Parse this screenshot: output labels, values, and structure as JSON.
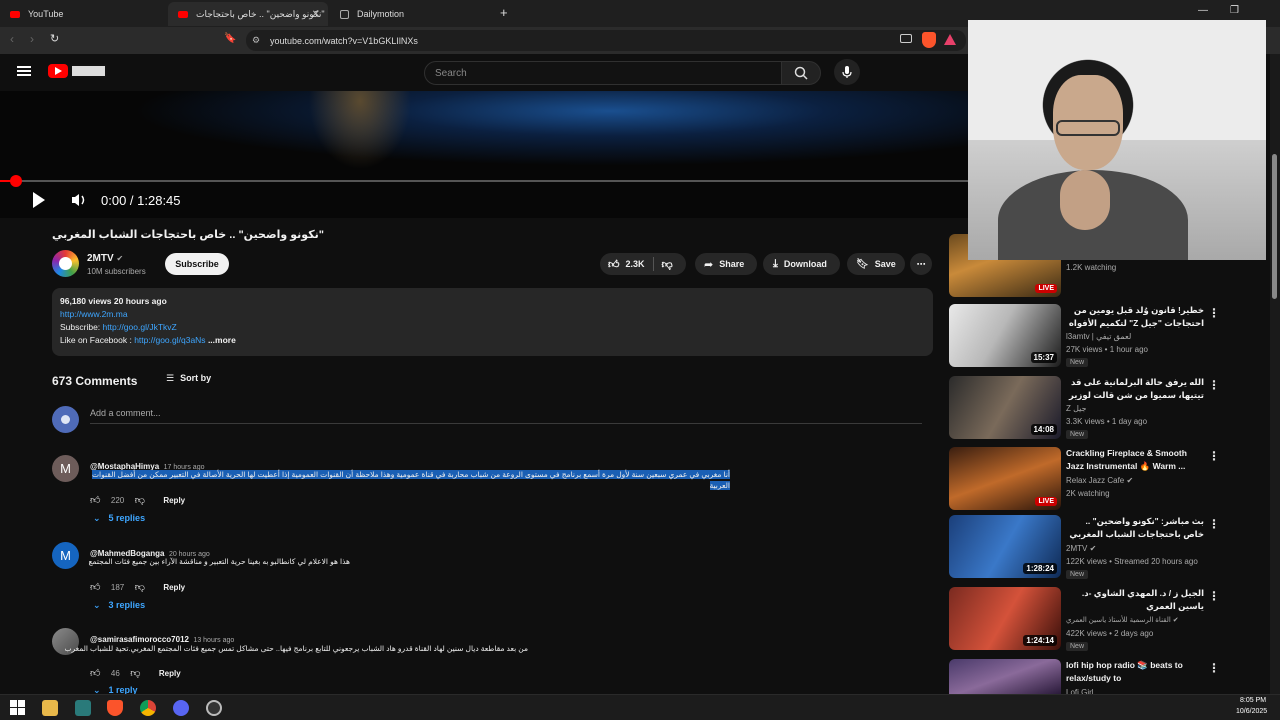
{
  "browser": {
    "tabs": [
      {
        "label": "YouTube"
      },
      {
        "label": "\"نكونو واضحين\" .. خاص باحتجاجات"
      },
      {
        "label": "Dailymotion"
      }
    ],
    "url": "youtube.com/watch?v=V1bGKLIlNXs"
  },
  "header": {
    "search_placeholder": "Search"
  },
  "player": {
    "time": "0:00 / 1:28:45",
    "progress_fraction": 0.0
  },
  "video": {
    "title": "\"نكونو واضحين\" .. خاص باحتجاجات الشباب المغربي",
    "channel": "2MTV",
    "subscribers": "10M subscribers",
    "subscribe_label": "Subscribe",
    "likes": "2.3K",
    "share_label": "Share",
    "download_label": "Download",
    "save_label": "Save"
  },
  "description": {
    "stats": "96,180 views  20 hours ago",
    "link1": "http://www.2m.ma",
    "subscribe_prefix": "Subscribe:",
    "subscribe_link": "http://goo.gl/JkTkvZ",
    "facebook_prefix": "Like on Facebook :",
    "facebook_link": "http://goo.gl/q3aNs",
    "more": "...more"
  },
  "comments": {
    "count_label": "673 Comments",
    "sort_label": "Sort by",
    "add_placeholder": "Add a comment...",
    "items": [
      {
        "avatar_letter": "M",
        "handle": "@MostaphaHimya",
        "time": "17 hours ago",
        "line1": "أنا مغربي في عمري سبعين سنة لأول مرة أسمع برنامج في مستوى الروعة من شباب محاربة في قناة عمومية وهذا ملاحظة أن القنوات العمومية إذا أعطيت لها الحرية الأصالة في التعبير  ممكن من أفضل القنوات العربية",
        "likes": "220",
        "reply": "Reply",
        "replies": "5 replies"
      },
      {
        "avatar_letter": "M",
        "handle": "@MahmedBoganga",
        "time": "20 hours ago",
        "line1": "هذا هو الاعلام لي كانطالبو به بغينا حرية التعبير و مناقشة الآراء بين جميع فئات المجتمع",
        "likes": "187",
        "reply": "Reply",
        "replies": "3 replies"
      },
      {
        "avatar_letter": "",
        "handle": "@samirasafimorocco7012",
        "time": "13 hours ago",
        "line1": "من بعد مقاطعة ديال سنين لهاد القناة قدرو هاد الشباب يرجعوني للتابع برنامج فيها.. حتى مشاكل تمس جميع فئات المجتمع المغربي.تحية للشباب المغرب",
        "likes": "46",
        "reply": "Reply",
        "replies": "1 reply"
      }
    ]
  },
  "sidebar": {
    "items": [
      {
        "title": "",
        "channel": "",
        "meta": "1.2K watching",
        "badge": "LIVE",
        "new": ""
      },
      {
        "title": "خطير! قانون وُلد قبل يومين من احتجاجات \"جيل Z\" لتكميم الأفواه .. هذه المطالب التي",
        "channel": "l3amtv | لعمق تيفي",
        "meta": "27K views • 1 hour ago",
        "badge": "15:37",
        "new": "New"
      },
      {
        "title": "الله يرفق حالة البرلمانية على قد تيتيها، سميوا من شن قالت لوزير الصحة عن بنكيران بعد",
        "channel": "Z جيل",
        "meta": "3.3K views • 1 day ago",
        "badge": "14:08",
        "new": "New"
      },
      {
        "title": "Crackling Fireplace & Smooth Jazz Instrumental 🔥 Warm ...",
        "channel": "Relax Jazz Cafe",
        "meta": "2K watching",
        "badge": "LIVE",
        "new": ""
      },
      {
        "title": "بث مباشر: \"نكونو واضحين\" .. خاص باحتجاجات الشباب المغربي",
        "channel": "2MTV",
        "meta": "122K views • Streamed 20 hours ago",
        "badge": "1:28:24",
        "new": "New"
      },
      {
        "title": "الجيل ز / د. المهدي الشاوي -د. ياسين العمري",
        "channel": "القناة الرسمية للأستاذ ياسين العمري",
        "meta": "422K views • 2 days ago",
        "badge": "1:24:14",
        "new": "New"
      },
      {
        "title": "lofi hip hop radio 📚 beats to relax/study to",
        "channel": "Lofi Girl",
        "meta": "",
        "badge": "",
        "new": ""
      }
    ]
  },
  "taskbar": {
    "time": "8:05 PM",
    "date": "10/6/2025"
  }
}
